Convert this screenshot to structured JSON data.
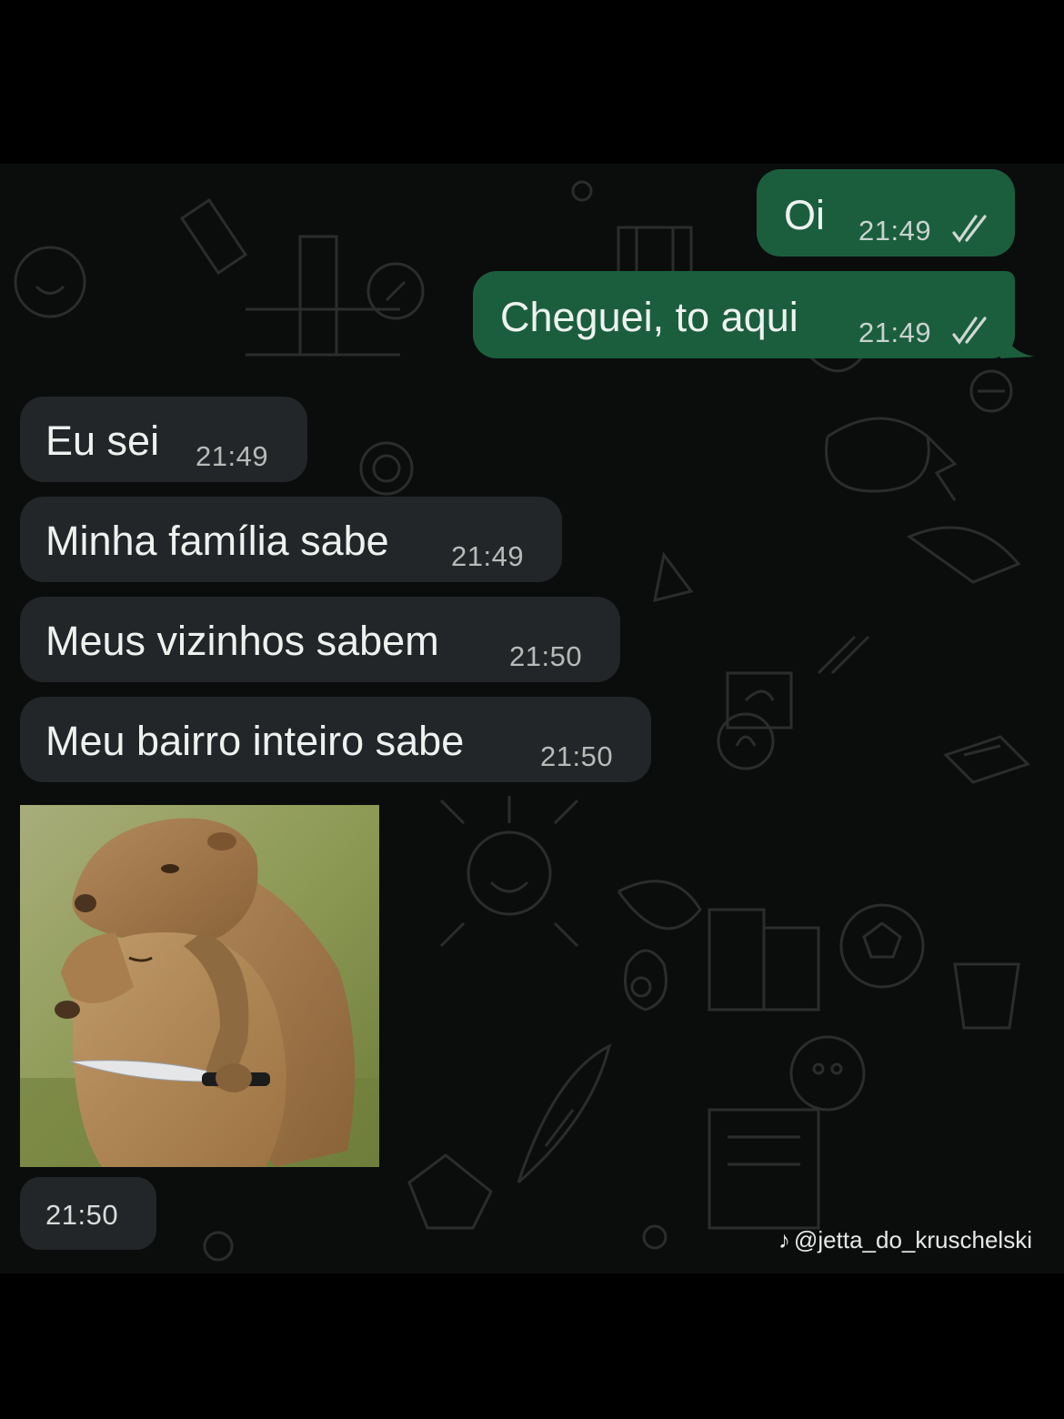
{
  "messages": [
    {
      "direction": "outgoing",
      "text": "Oi",
      "time": "21:49",
      "status_icon": "double-check-icon"
    },
    {
      "direction": "outgoing",
      "text": "Cheguei, to aqui",
      "time": "21:49",
      "status_icon": "double-check-icon"
    },
    {
      "direction": "incoming",
      "text": "Eu sei",
      "time": "21:49"
    },
    {
      "direction": "incoming",
      "text": "Minha família sabe",
      "time": "21:49"
    },
    {
      "direction": "incoming",
      "text": "Meus vizinhos sabem",
      "time": "21:50"
    },
    {
      "direction": "incoming",
      "text": "Meu bairro inteiro sabe",
      "time": "21:50"
    },
    {
      "direction": "incoming",
      "type": "image",
      "image_icon": "capybara-with-knife-photo",
      "time": "21:50"
    }
  ],
  "watermark": {
    "icon": "tiktok-icon",
    "text": "@jetta_do_kruschelski"
  },
  "colors": {
    "outgoing_bubble": "#1b5e3e",
    "incoming_bubble": "#232628",
    "chat_background": "#0b0d0c",
    "page_background": "#000000"
  }
}
